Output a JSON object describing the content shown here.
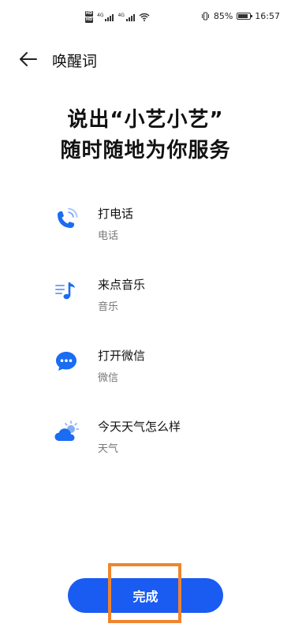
{
  "status_bar": {
    "hd_badges": [
      "HD",
      "HD"
    ],
    "network_labels": [
      "4G",
      "4G"
    ],
    "battery_percent": "85%",
    "battery_level": 0.85,
    "time": "16:57",
    "icons": [
      "hd-icon",
      "signal-icon",
      "wifi-icon",
      "vibrate-icon",
      "battery-icon"
    ]
  },
  "header": {
    "title": "唤醒词",
    "back_icon": "back-arrow-icon"
  },
  "headline": {
    "line1": "说出“小艺小艺”",
    "line2": "随时随地为你服务"
  },
  "suggestions": [
    {
      "title": "打电话",
      "subtitle": "电话",
      "icon": "phone-call-icon"
    },
    {
      "title": "来点音乐",
      "subtitle": "音乐",
      "icon": "music-note-icon"
    },
    {
      "title": "打开微信",
      "subtitle": "微信",
      "icon": "chat-bubble-icon"
    },
    {
      "title": "今天天气怎么样",
      "subtitle": "天气",
      "icon": "weather-icon"
    }
  ],
  "actions": {
    "done_label": "完成"
  },
  "colors": {
    "accent": "#1a5cf2",
    "highlight": "#f0852d",
    "icon_blue": "#1a6cf2",
    "secondary_text": "#777777"
  }
}
